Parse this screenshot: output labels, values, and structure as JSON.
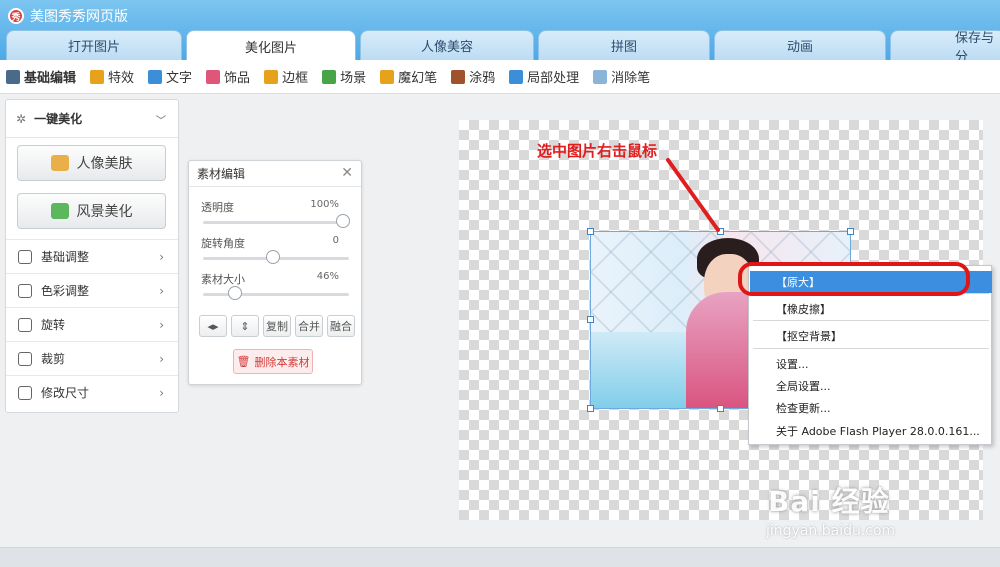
{
  "app": {
    "title": "美图秀秀网页版"
  },
  "tabs": [
    {
      "label": "打开图片"
    },
    {
      "label": "美化图片"
    },
    {
      "label": "人像美容"
    },
    {
      "label": "拼图"
    },
    {
      "label": "动画"
    },
    {
      "label": "保存与分"
    }
  ],
  "toolbar": [
    {
      "label": "基础编辑",
      "icon": "list-icon",
      "color": "#4a6a8a"
    },
    {
      "label": "特效",
      "icon": "wand-icon",
      "color": "#e6a21a"
    },
    {
      "label": "文字",
      "icon": "text-icon",
      "color": "#3a8fd8"
    },
    {
      "label": "饰品",
      "icon": "bow-icon",
      "color": "#e0557a"
    },
    {
      "label": "边框",
      "icon": "frame-icon",
      "color": "#e6a21a"
    },
    {
      "label": "场景",
      "icon": "landscape-icon",
      "color": "#47a447"
    },
    {
      "label": "魔幻笔",
      "icon": "pen-icon",
      "color": "#e6a21a"
    },
    {
      "label": "涂鸦",
      "icon": "brush-icon",
      "color": "#a0522d"
    },
    {
      "label": "局部处理",
      "icon": "pencil-icon",
      "color": "#3a8fd8"
    },
    {
      "label": "消除笔",
      "icon": "eraser-icon",
      "color": "#8ab4d8"
    }
  ],
  "left_panel": {
    "header": "一键美化",
    "portrait_button": "人像美肤",
    "landscape_button": "风景美化",
    "menu": [
      {
        "label": "基础调整",
        "icon": "sliders-icon"
      },
      {
        "label": "色彩调整",
        "icon": "palette-icon"
      },
      {
        "label": "旋转",
        "icon": "rotate-icon"
      },
      {
        "label": "裁剪",
        "icon": "crop-icon"
      },
      {
        "label": "修改尺寸",
        "icon": "resize-icon"
      }
    ]
  },
  "material_panel": {
    "title": "素材编辑",
    "sliders": [
      {
        "label": "透明度",
        "value": "100%",
        "level": 1.0
      },
      {
        "label": "旋转角度",
        "value": "0",
        "level": 0.5
      },
      {
        "label": "素材大小",
        "value": "46%",
        "level": 0.23
      }
    ],
    "buttons": [
      "",
      "",
      "复制",
      "合并",
      "融合"
    ],
    "delete_label": "删除本素材"
  },
  "annotation": "选中图片右击鼠标",
  "context_menu": [
    {
      "label": "【原大】",
      "highlighted": true
    },
    {
      "label": "【橡皮擦】",
      "highlighted": false
    },
    {
      "label": "【抠空背景】",
      "highlighted": false
    },
    {
      "label": "设置...",
      "highlighted": false
    },
    {
      "label": "全局设置...",
      "highlighted": false
    },
    {
      "label": "检查更新...",
      "highlighted": false
    },
    {
      "label": "关于 Adobe Flash Player 28.0.0.161...",
      "highlighted": false
    }
  ],
  "watermark": {
    "main": "Bai  经验",
    "sub": "jingyan.baidu.com"
  },
  "colors": {
    "accent": "#4fa9e6",
    "highlight": "#3c8fe0",
    "annotation": "#e01e1e"
  }
}
